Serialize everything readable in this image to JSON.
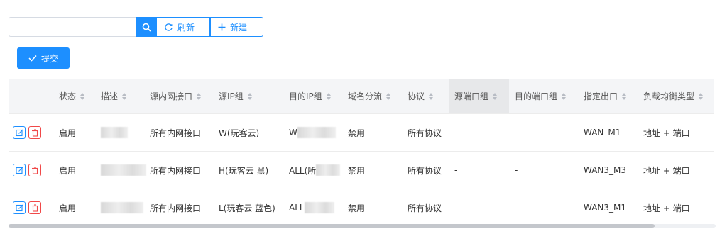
{
  "toolbar": {
    "search_value": "",
    "refresh_label": "刷新",
    "new_label": "新建"
  },
  "submit_label": "提交",
  "columns": {
    "status": "状态",
    "description": "描述",
    "src_interface": "源内网接口",
    "src_ip_group": "源IP组",
    "dst_ip_group": "目的IP组",
    "domain_split": "域名分流",
    "protocol": "协议",
    "src_port_group": "源端口组",
    "dst_port_group": "目的端口组",
    "outbound": "指定出口",
    "lb_type": "负载均衡类型"
  },
  "rows": [
    {
      "status": "启用",
      "description": "",
      "src_interface": "所有内网接口",
      "src_ip_group": "W(玩客云)",
      "dst_ip_group": "W",
      "domain_split": "禁用",
      "protocol": "所有协议",
      "src_port_group": "-",
      "dst_port_group": "-",
      "outbound": "WAN_M1",
      "lb_type": "地址 + 端口"
    },
    {
      "status": "启用",
      "description": "",
      "src_interface": "所有内网接口",
      "src_ip_group": "H(玩客云 黑)",
      "dst_ip_group": "ALL(所",
      "domain_split": "禁用",
      "protocol": "所有协议",
      "src_port_group": "-",
      "dst_port_group": "-",
      "outbound": "WAN3_M3",
      "lb_type": "地址 + 端口"
    },
    {
      "status": "启用",
      "description": "",
      "src_interface": "所有内网接口",
      "src_ip_group": "L(玩客云 蓝色)",
      "dst_ip_group": "ALL",
      "domain_split": "禁用",
      "protocol": "所有协议",
      "src_port_group": "-",
      "dst_port_group": "-",
      "outbound": "WAN3_M1",
      "lb_type": "地址 + 端口"
    }
  ],
  "icons": {
    "search": "search-icon",
    "refresh": "refresh-icon",
    "new": "plus-icon",
    "submit": "check-icon",
    "edit": "edit-icon",
    "delete": "trash-icon"
  },
  "colors": {
    "primary": "#1d8fff",
    "danger": "#f04848",
    "header_bg": "#f4f5f7"
  }
}
